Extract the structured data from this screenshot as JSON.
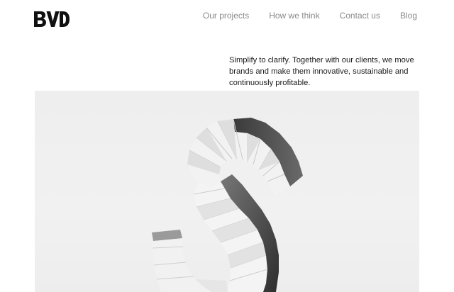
{
  "brand": {
    "logo_text": "BVD"
  },
  "nav": {
    "items": [
      {
        "label": "Our projects"
      },
      {
        "label": "How we think"
      },
      {
        "label": "Contact us"
      },
      {
        "label": "Blog"
      }
    ]
  },
  "intro": {
    "text": "Simplify to clarify. Together with our clients, we move brands and make them innovative, sustainable and continuously profitable."
  },
  "hero": {
    "subject": "folded-paper-letter-s-sculpture"
  }
}
